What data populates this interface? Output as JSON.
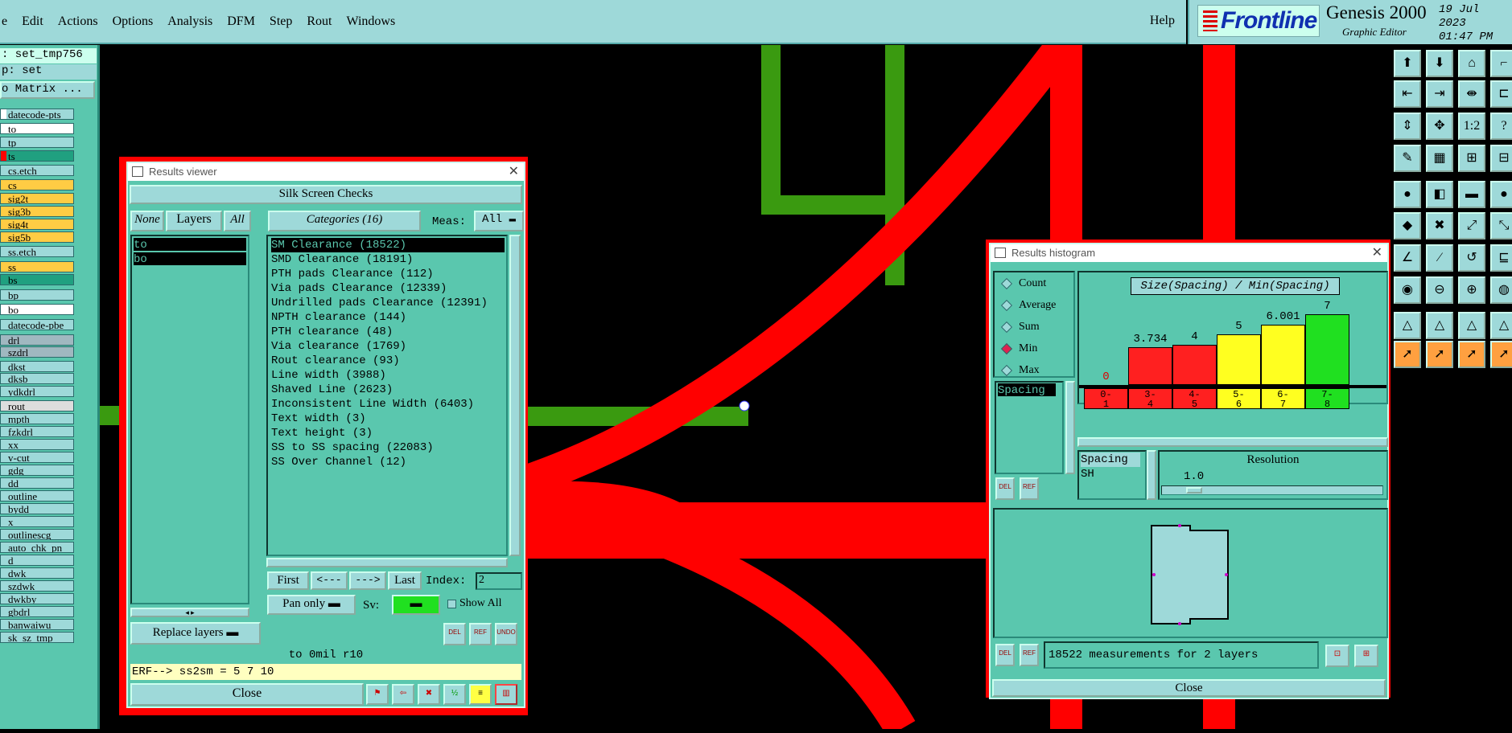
{
  "menubar": {
    "items": [
      "e",
      "Edit",
      "Actions",
      "Options",
      "Analysis",
      "DFM",
      "Step",
      "Rout",
      "Windows"
    ],
    "help": "Help"
  },
  "brand": {
    "logo": "Frontline",
    "product": "Genesis 2000",
    "subtitle": "Graphic Editor",
    "date": "19 Jul 2023",
    "time": "01:47 PM"
  },
  "job": {
    "name": ": set_tmp756",
    "step": "p: set",
    "matrix_button": "o Matrix ..."
  },
  "layers": [
    {
      "name": "datecode-pts",
      "color": "#ffffff",
      "bg": "#9ed9d9"
    },
    {
      "name": "to",
      "color": "#ffffff",
      "bg": "#ffffff"
    },
    {
      "name": "tp",
      "color": "#9ed9d9",
      "bg": "#9ed9d9"
    },
    {
      "name": "ts",
      "color": "#ff0000",
      "bg": "#20a080"
    },
    {
      "name": "cs.etch",
      "color": "#9ed9d9",
      "bg": "#9ed9d9"
    },
    {
      "name": "cs",
      "color": "#ffcc44",
      "bg": "#ffcc44"
    },
    {
      "name": "sig2t",
      "color": "#ffcc44",
      "bg": "#ffcc44"
    },
    {
      "name": "sig3b",
      "color": "#ffcc44",
      "bg": "#ffcc44"
    },
    {
      "name": "sig4t",
      "color": "#ffcc44",
      "bg": "#ffcc44"
    },
    {
      "name": "sig5b",
      "color": "#ffcc44",
      "bg": "#ffcc44"
    },
    {
      "name": "ss.etch",
      "color": "#9ed9d9",
      "bg": "#9ed9d9"
    },
    {
      "name": "ss",
      "color": "#ffcc44",
      "bg": "#ffcc44"
    },
    {
      "name": "bs",
      "color": "#20a080",
      "bg": "#20a080"
    },
    {
      "name": "bp",
      "color": "#9ed9d9",
      "bg": "#9ed9d9"
    },
    {
      "name": "bo",
      "color": "#ffffff",
      "bg": "#ffffff"
    },
    {
      "name": "datecode-pbe",
      "color": "#9ed9d9",
      "bg": "#9ed9d9"
    },
    {
      "name": "drl",
      "color": "#a0b8c0",
      "bg": "#a0b8c0"
    },
    {
      "name": "szdrl",
      "color": "#a0b8c0",
      "bg": "#a0b8c0"
    },
    {
      "name": "dkst",
      "color": "#9ed9d9",
      "bg": "#9ed9d9"
    },
    {
      "name": "dksb",
      "color": "#9ed9d9",
      "bg": "#9ed9d9"
    },
    {
      "name": "ydkdrl",
      "color": "#9ed9d9",
      "bg": "#9ed9d9"
    },
    {
      "name": "rout",
      "color": "#dddddd",
      "bg": "#dddddd"
    },
    {
      "name": "mpth",
      "color": "#9ed9d9",
      "bg": "#9ed9d9"
    },
    {
      "name": "fzkdrl",
      "color": "#9ed9d9",
      "bg": "#9ed9d9"
    },
    {
      "name": "xx",
      "color": "#9ed9d9",
      "bg": "#9ed9d9"
    },
    {
      "name": "v-cut",
      "color": "#9ed9d9",
      "bg": "#9ed9d9"
    },
    {
      "name": "gdg",
      "color": "#9ed9d9",
      "bg": "#9ed9d9"
    },
    {
      "name": "dd",
      "color": "#9ed9d9",
      "bg": "#9ed9d9"
    },
    {
      "name": "outline",
      "color": "#9ed9d9",
      "bg": "#9ed9d9"
    },
    {
      "name": "bydd",
      "color": "#9ed9d9",
      "bg": "#9ed9d9"
    },
    {
      "name": "x",
      "color": "#9ed9d9",
      "bg": "#9ed9d9"
    },
    {
      "name": "outlinescg",
      "color": "#9ed9d9",
      "bg": "#9ed9d9"
    },
    {
      "name": "auto_chk_pn",
      "color": "#9ed9d9",
      "bg": "#9ed9d9"
    },
    {
      "name": "d",
      "color": "#9ed9d9",
      "bg": "#9ed9d9"
    },
    {
      "name": "dwk",
      "color": "#9ed9d9",
      "bg": "#9ed9d9"
    },
    {
      "name": "szdwk",
      "color": "#9ed9d9",
      "bg": "#9ed9d9"
    },
    {
      "name": "dwkby",
      "color": "#9ed9d9",
      "bg": "#9ed9d9"
    },
    {
      "name": "gbdrl",
      "color": "#9ed9d9",
      "bg": "#9ed9d9"
    },
    {
      "name": "banwaiwu",
      "color": "#9ed9d9",
      "bg": "#9ed9d9"
    },
    {
      "name": "sk_sz_tmp",
      "color": "#9ed9d9",
      "bg": "#9ed9d9"
    }
  ],
  "results_viewer": {
    "title": "Results viewer",
    "header": "Silk Screen Checks",
    "none": "None",
    "layers": "Layers",
    "all": "All",
    "categories_label": "Categories (16)",
    "meas_label": "Meas:",
    "meas_value": "All",
    "layer_items": [
      "to",
      "bo"
    ],
    "categories": [
      "SM Clearance (18522)",
      "SMD Clearance (18191)",
      "PTH pads Clearance (112)",
      "Via pads Clearance (12339)",
      "Undrilled pads Clearance (12391)",
      "NPTH clearance (144)",
      "PTH clearance (48)",
      "Via clearance (1769)",
      "Rout clearance (93)",
      "Line width (3988)",
      "Shaved Line (2623)",
      "Inconsistent Line Width (6403)",
      "Text width (3)",
      "Text height (3)",
      "SS to SS spacing (22083)",
      "SS Over Channel (12)"
    ],
    "first": "First",
    "prev": "<---",
    "next": "--->",
    "last": "Last",
    "index_label": "Index:",
    "index_value": "2",
    "pan_mode": "Pan only",
    "sv_label": "Sv:",
    "show_all": "Show All",
    "replace_layers": "Replace layers",
    "status": "to 0mil  r10",
    "erf": "ERF--> ss2sm = 5 7 10",
    "close": "Close",
    "del": "DEL",
    "ref": "REF",
    "undo": "UNDO"
  },
  "results_histogram": {
    "title": "Results histogram",
    "modes": [
      {
        "label": "Count",
        "selected": false
      },
      {
        "label": "Average",
        "selected": false
      },
      {
        "label": "Sum",
        "selected": false
      },
      {
        "label": "Min",
        "selected": true
      },
      {
        "label": "Max",
        "selected": false
      }
    ],
    "list_items": [
      "Spacing"
    ],
    "chart_title": "Size(Spacing) / Min(Spacing)",
    "resolution_label": "Resolution",
    "resolution_value": "1.0",
    "filter_items": [
      "Spacing",
      "SH"
    ],
    "summary": "18522 measurements for 2 layers",
    "close": "Close",
    "del": "DEL",
    "ref": "REF"
  },
  "chart_data": {
    "type": "bar",
    "title": "Size(Spacing) / Min(Spacing)",
    "categories": [
      "0-1",
      "3-4",
      "4-5",
      "5-6",
      "6-7",
      "7-8"
    ],
    "values": [
      0,
      3.734,
      4,
      5,
      6.001,
      7
    ],
    "labels": [
      "0",
      "3.734",
      "4",
      "5",
      "6.001",
      "7"
    ],
    "colors": [
      "#ff2020",
      "#ff2020",
      "#ff2020",
      "#ffff20",
      "#ffff20",
      "#20e020"
    ]
  }
}
